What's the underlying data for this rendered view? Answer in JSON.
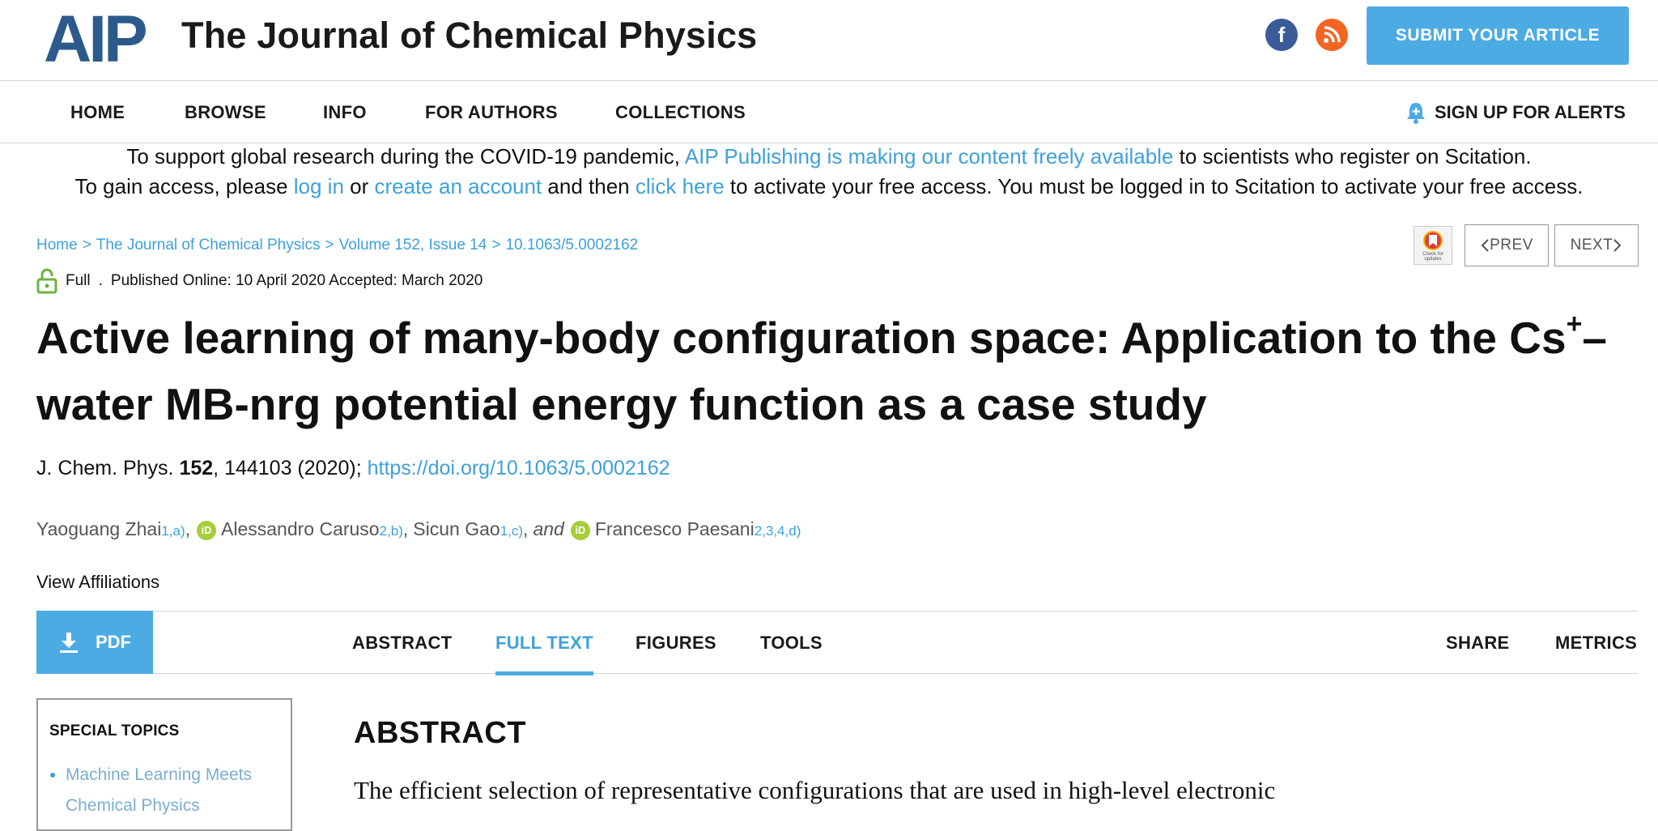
{
  "header": {
    "logo_text": "AIP",
    "journal_title": "The Journal of Chemical Physics",
    "facebook_icon": "facebook-icon",
    "rss_icon": "rss-icon",
    "submit_label": "SUBMIT YOUR ARTICLE"
  },
  "nav": {
    "items": [
      "HOME",
      "BROWSE",
      "INFO",
      "FOR AUTHORS",
      "COLLECTIONS"
    ],
    "alerts_label": "SIGN UP FOR ALERTS"
  },
  "notice": {
    "line1_a": "To support global research during the COVID-19 pandemic, ",
    "line1_link": "AIP Publishing is making our content freely available",
    "line1_b": " to scientists who register on Scitation.",
    "line2_a": "To gain access, please ",
    "line2_login": "log in",
    "line2_b": " or ",
    "line2_create": "create an account",
    "line2_c": " and then ",
    "line2_click": "click here",
    "line2_d": " to activate your free access. You must be logged in to Scitation to activate your free access."
  },
  "breadcrumb": [
    "Home",
    "The Journal of Chemical Physics",
    "Volume 152, Issue 14",
    "10.1063/5.0002162"
  ],
  "breadcrumb_sep": ">",
  "publication": {
    "access": "Full",
    "dot": ".",
    "dates": "Published Online: 10 April 2020 Accepted: March 2020"
  },
  "pager": {
    "check_updates": "Check for updates",
    "prev": "PREV",
    "next": "NEXT"
  },
  "article": {
    "title_part1": "Active learning of many-body configuration space: Application to the Cs",
    "title_sup": "+",
    "title_part2": "–water MB-nrg potential energy function as a case study",
    "cite_journal": "J. Chem. Phys. ",
    "cite_volume": "152",
    "cite_rest": ", 144103 (2020); ",
    "doi": "https://doi.org/10.1063/5.0002162",
    "authors": [
      {
        "name": "Yaoguang Zhai",
        "aff": "1,a)"
      },
      {
        "name": "Alessandro Caruso",
        "aff": "2,b)"
      },
      {
        "name": "Sicun Gao",
        "aff": "1,c)"
      },
      {
        "name": "Francesco Paesani",
        "aff": "2,3,4,d)"
      }
    ],
    "and_text": "and",
    "orcid": "iD",
    "view_affiliations": "View Affiliations"
  },
  "tabs": {
    "pdf": "PDF",
    "items": [
      "ABSTRACT",
      "FULL TEXT",
      "FIGURES",
      "TOOLS"
    ],
    "active": "FULL TEXT",
    "share": "SHARE",
    "metrics": "METRICS"
  },
  "sidebar": {
    "heading": "SPECIAL TOPICS",
    "item": "Machine Learning Meets Chemical Physics"
  },
  "abstract": {
    "heading": "ABSTRACT",
    "text": "The efficient selection of representative configurations that are used in high-level electronic"
  },
  "colors": {
    "accent": "#4dabe4",
    "link": "#3ea1d9",
    "facebook": "#3a5a98",
    "rss": "#f26522",
    "orcid": "#a6ce39"
  }
}
